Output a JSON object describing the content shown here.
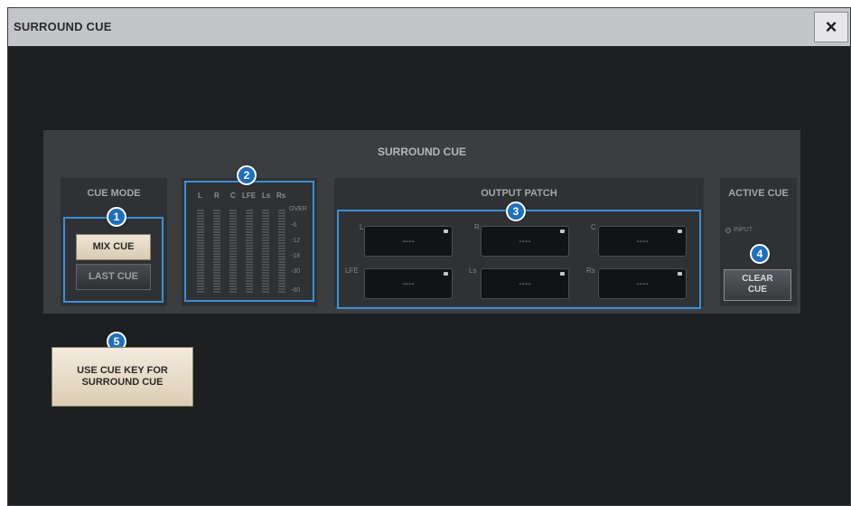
{
  "window": {
    "title": "SURROUND CUE",
    "close_icon": "×"
  },
  "panel": {
    "title": "SURROUND CUE"
  },
  "cue_mode": {
    "title": "CUE MODE",
    "mix_cue": "MIX CUE",
    "last_cue": "LAST CUE"
  },
  "meter": {
    "channels": [
      "L",
      "R",
      "C",
      "LFE",
      "Ls",
      "Rs"
    ],
    "scale": [
      "OVER",
      "-6",
      "-12",
      "-18",
      "-30",
      "-60"
    ]
  },
  "output_patch": {
    "title": "OUTPUT PATCH",
    "slots": [
      {
        "label": "L",
        "value": "----"
      },
      {
        "label": "R",
        "value": "----"
      },
      {
        "label": "C",
        "value": "----"
      },
      {
        "label": "LFE",
        "value": "----"
      },
      {
        "label": "Ls",
        "value": "----"
      },
      {
        "label": "Rs",
        "value": "----"
      }
    ]
  },
  "active_cue": {
    "title": "ACTIVE CUE",
    "input_label": "INPUT",
    "clear_line1": "CLEAR",
    "clear_line2": "CUE"
  },
  "use_cue_key": {
    "line1": "USE CUE KEY FOR",
    "line2": "SURROUND CUE"
  },
  "callouts": [
    "1",
    "2",
    "3",
    "4",
    "5"
  ],
  "colors": {
    "highlight": "#3a8fd8",
    "badge": "#1f6fbf",
    "panel": "#3b3d41",
    "window_bg": "#1e1f21"
  }
}
